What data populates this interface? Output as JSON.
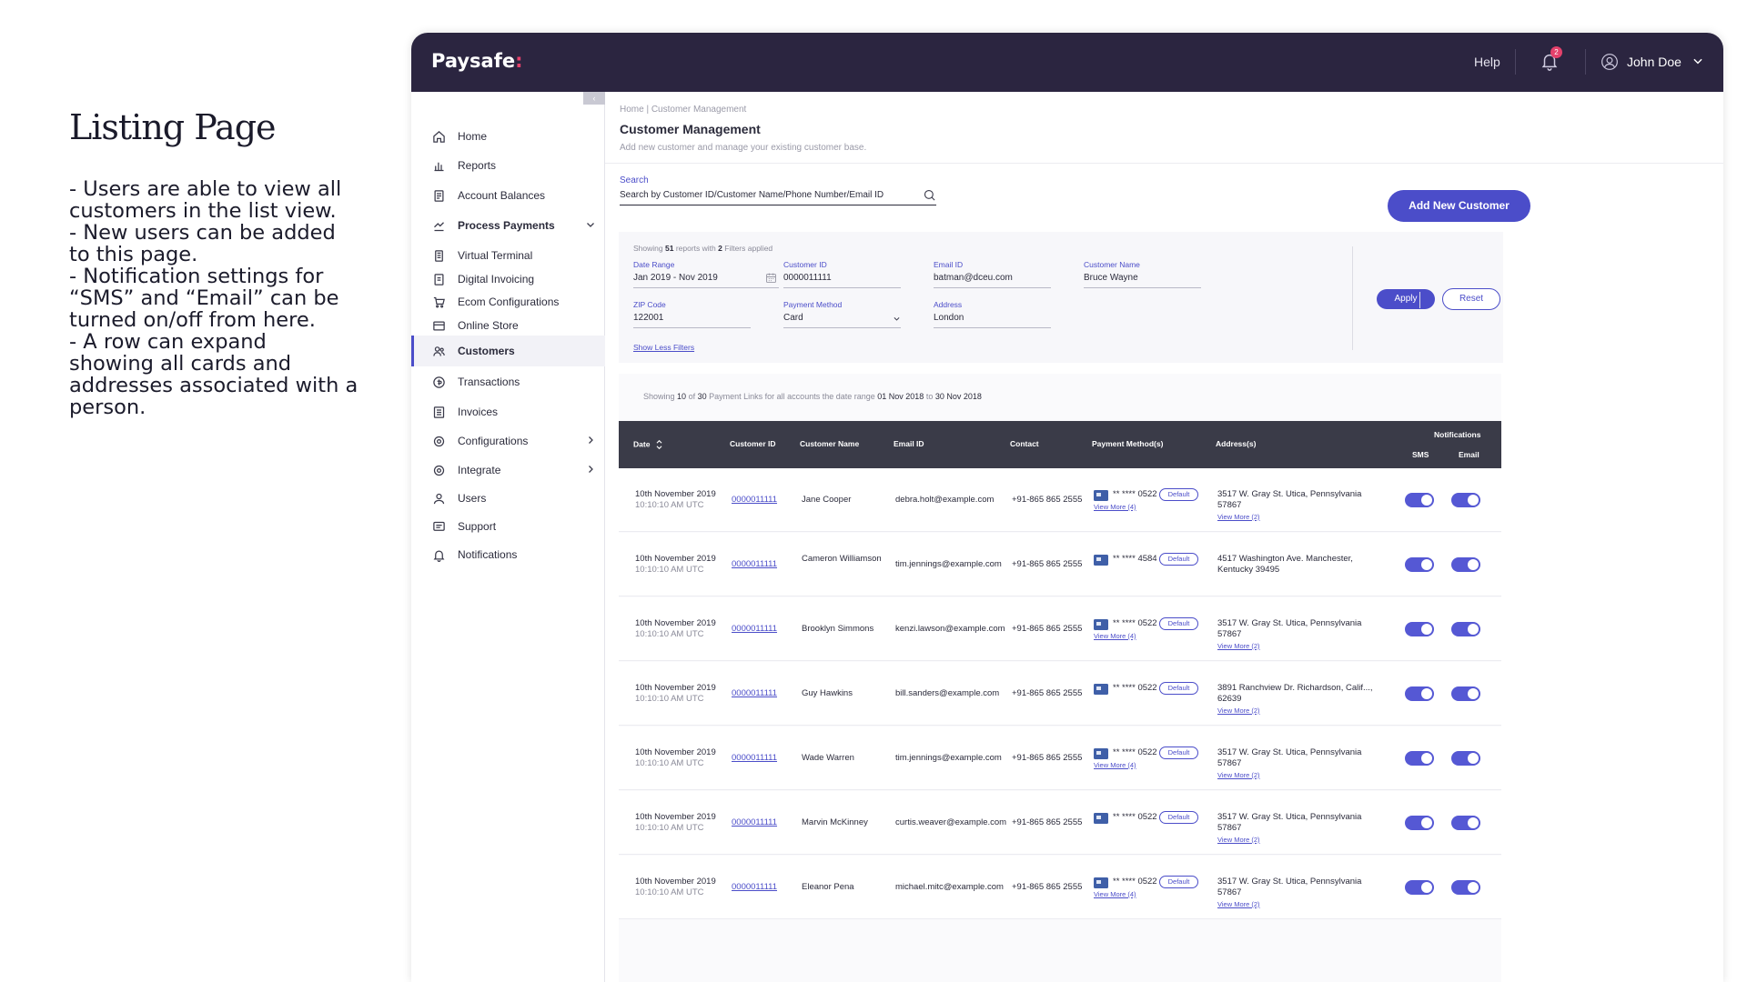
{
  "description": {
    "title": "Listing Page",
    "lines": [
      "- Users are able to view all",
      "customers in the list view.",
      "- New users can be added",
      "to this page.",
      "- Notification settings for",
      "“SMS” and “Email” can be",
      "turned on/off from here.",
      "- A row can expand",
      "showing all cards and",
      "addresses associated with a",
      "person."
    ]
  },
  "topbar": {
    "logo": "Paysafe",
    "logo_dot": ":",
    "help": "Help",
    "notification_count": "2",
    "user_name": "John Doe",
    "brand_color": "#2b2540",
    "accent_color": "#4b4dc9"
  },
  "sidebar": {
    "collapse_icon": "‹",
    "items": [
      {
        "label": "Home",
        "icon": "home-icon"
      },
      {
        "label": "Reports",
        "icon": "reports-icon"
      },
      {
        "label": "Account Balances",
        "icon": "document-icon"
      },
      {
        "label": "Process Payments",
        "icon": "payments-icon"
      },
      {
        "label": "Virtual Terminal",
        "icon": "terminal-icon"
      },
      {
        "label": "Digital Invoicing",
        "icon": "invoice-icon"
      },
      {
        "label": "Ecom Configurations",
        "icon": "cart-icon"
      },
      {
        "label": "Online Store",
        "icon": "store-icon"
      },
      {
        "label": "Customers",
        "icon": "customers-icon"
      },
      {
        "label": "Transactions",
        "icon": "transactions-icon"
      },
      {
        "label": "Invoices",
        "icon": "invoices-icon"
      },
      {
        "label": "Configurations",
        "icon": "gear-icon"
      },
      {
        "label": "Integrate",
        "icon": "integrate-icon"
      },
      {
        "label": "Users",
        "icon": "users-icon"
      },
      {
        "label": "Support",
        "icon": "support-icon"
      },
      {
        "label": "Notifications",
        "icon": "bell-icon"
      }
    ]
  },
  "header": {
    "breadcrumb": "Home  |  Customer Management",
    "title": "Customer Management",
    "subtitle": "Add new customer and manage your existing customer base."
  },
  "search": {
    "label": "Search",
    "placeholder": "Search by Customer ID/Customer Name/Phone Number/Email ID"
  },
  "add_button": "Add New Customer",
  "filters": {
    "showing_prefix": "Showing",
    "showing_count": "51",
    "showing_middle": "reports with",
    "filter_count": "2",
    "showing_suffix": "Filters applied",
    "date_range_label": "Date Range",
    "date_range_value": "Jan 2019 - Nov 2019",
    "customer_id_label": "Customer ID",
    "customer_id_value": "0000011111",
    "email_label": "Email ID",
    "email_value": "batman@dceu.com",
    "customer_name_label": "Customer Name",
    "customer_name_value": "Bruce Wayne",
    "zip_label": "ZIP Code",
    "zip_value": "122001",
    "payment_method_label": "Payment Method",
    "payment_method_value": "Card",
    "address_label": "Address",
    "address_value": "London",
    "show_less": "Show Less Filters",
    "apply": "Apply",
    "reset": "Reset"
  },
  "table": {
    "summary_prefix": "Showing",
    "summary_shown": "10",
    "summary_of": "of",
    "summary_total": "30",
    "summary_middle": "Payment Links for all accounts  the date range",
    "summary_from": "01 Nov 2018",
    "summary_to_word": "to",
    "summary_to": "30 Nov 2018",
    "headers": {
      "date": "Date",
      "customer_id": "Customer ID",
      "customer_name": "Customer Name",
      "email": "Email ID",
      "contact": "Contact",
      "payment": "Payment Method(s)",
      "address": "Address(s)",
      "notifications": "Notifications",
      "sms": "SMS",
      "email_col": "Email"
    },
    "rows": [
      {
        "date": "10th November 2019",
        "time": "10:10:10 AM UTC",
        "id": "0000011111",
        "name": "Jane Cooper",
        "email": "debra.holt@example.com",
        "contact": "+91-865 865 2555",
        "card": "** **** 0522",
        "default": "Default",
        "card_more": "View More (4)",
        "address": "3517 W. Gray St. Utica, Pennsylvania 57867",
        "address_more": "View More (2)",
        "sms": true,
        "email_on": true
      },
      {
        "date": "10th November 2019",
        "time": "10:10:10 AM UTC",
        "id": "0000011111",
        "name": "Cameron Williamson",
        "email": "tim.jennings@example.com",
        "contact": "+91-865 865 2555",
        "card": "** **** 4584",
        "default": "Default",
        "card_more": "",
        "address": "4517 Washington Ave. Manchester, Kentucky 39495",
        "address_more": "",
        "sms": true,
        "email_on": true
      },
      {
        "date": "10th November 2019",
        "time": "10:10:10 AM UTC",
        "id": "0000011111",
        "name": "Brooklyn Simmons",
        "email": "kenzi.lawson@example.com",
        "contact": "+91-865 865 2555",
        "card": "** **** 0522",
        "default": "Default",
        "card_more": "View More (4)",
        "address": "3517 W. Gray St. Utica, Pennsylvania 57867",
        "address_more": "View More (2)",
        "sms": true,
        "email_on": true
      },
      {
        "date": "10th November 2019",
        "time": "10:10:10 AM UTC",
        "id": "0000011111",
        "name": "Guy Hawkins",
        "email": "bill.sanders@example.com",
        "contact": "+91-865 865 2555",
        "card": "** **** 0522",
        "default": "Default",
        "card_more": "",
        "address": "3891 Ranchview Dr. Richardson, Calif..., 62639",
        "address_more": "View More (2)",
        "sms": true,
        "email_on": true
      },
      {
        "date": "10th November 2019",
        "time": "10:10:10 AM UTC",
        "id": "0000011111",
        "name": "Wade Warren",
        "email": "tim.jennings@example.com",
        "contact": "+91-865 865 2555",
        "card": "** **** 0522",
        "default": "Default",
        "card_more": "View More (4)",
        "address": "3517 W. Gray St. Utica, Pennsylvania 57867",
        "address_more": "View More (2)",
        "sms": true,
        "email_on": true
      },
      {
        "date": "10th November 2019",
        "time": "10:10:10 AM UTC",
        "id": "0000011111",
        "name": "Marvin McKinney",
        "email": "curtis.weaver@example.com",
        "contact": "+91-865 865 2555",
        "card": "** **** 0522",
        "default": "Default",
        "card_more": "",
        "address": "3517 W. Gray St. Utica, Pennsylvania 57867",
        "address_more": "View More (2)",
        "sms": true,
        "email_on": true
      },
      {
        "date": "10th November 2019",
        "time": "10:10:10 AM UTC",
        "id": "0000011111",
        "name": "Eleanor Pena",
        "email": "michael.mitc@example.com",
        "contact": "+91-865 865 2555",
        "card": "** **** 0522",
        "default": "Default",
        "card_more": "View More (4)",
        "address": "3517 W. Gray St. Utica, Pennsylvania 57867",
        "address_more": "View More (2)",
        "sms": true,
        "email_on": true
      }
    ]
  }
}
